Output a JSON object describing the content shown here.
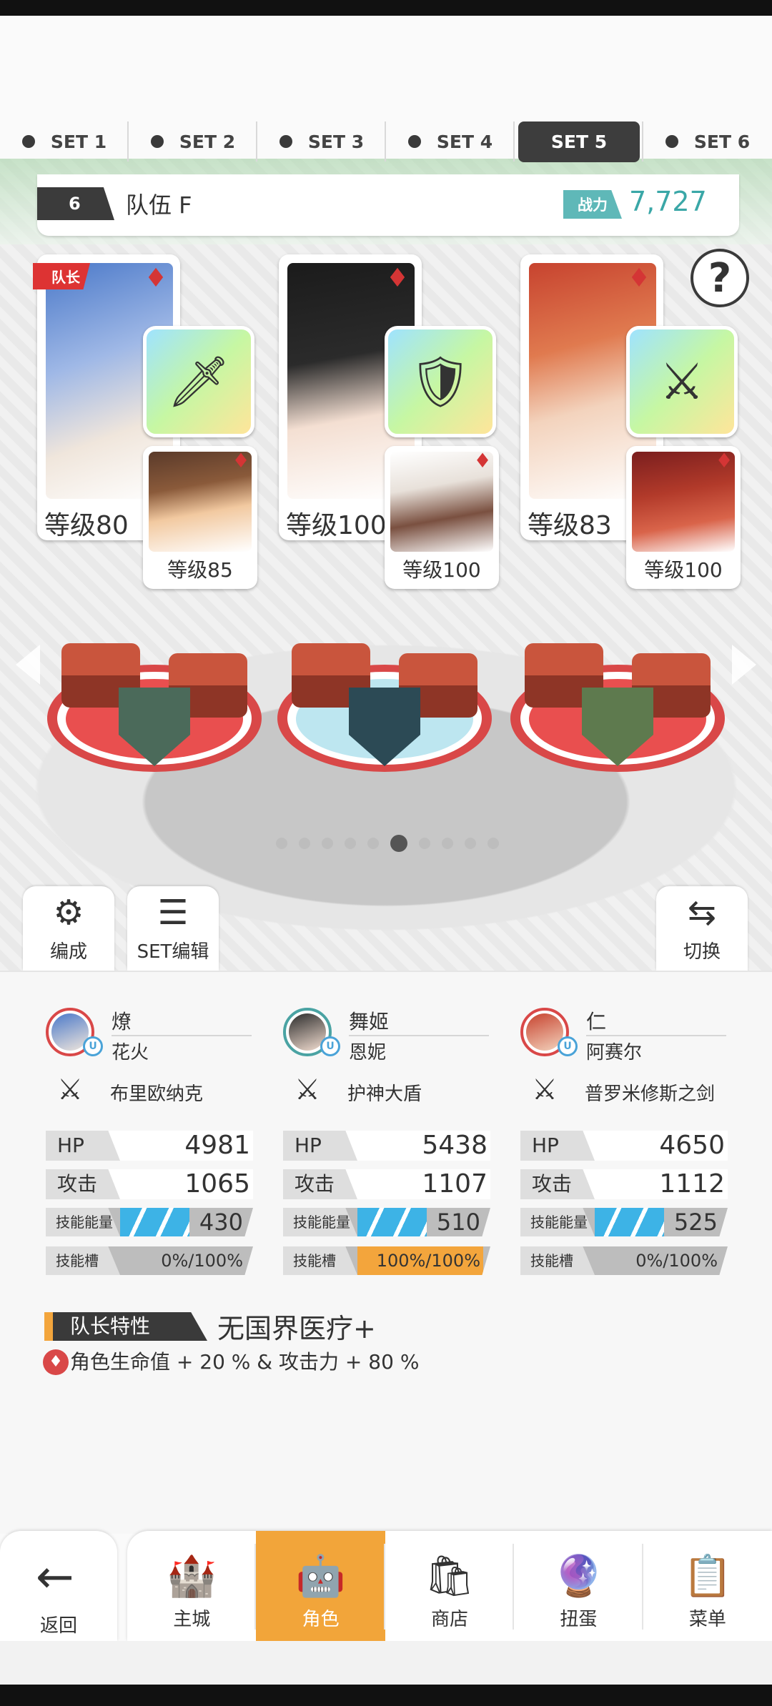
{
  "sets": [
    {
      "label": "SET 1",
      "active": false
    },
    {
      "label": "SET 2",
      "active": false
    },
    {
      "label": "SET 3",
      "active": false
    },
    {
      "label": "SET 4",
      "active": false
    },
    {
      "label": "SET 5",
      "active": true
    },
    {
      "label": "SET 6",
      "active": false
    }
  ],
  "team": {
    "number": "6",
    "name": "队伍 F",
    "power_label": "战力",
    "power_value": "7,727"
  },
  "help_symbol": "?",
  "leader_tag": "队长",
  "heroes": [
    {
      "level": "等级80",
      "sub_level": "等级85",
      "equip_icon": "staff-icon",
      "colors": {
        "main": "#4b79c9",
        "sub": "#8a5a3a"
      }
    },
    {
      "level": "等级100",
      "sub_level": "等级100",
      "equip_icon": "shield-emblem-icon",
      "colors": {
        "main": "#2b2b2b",
        "sub": "#e8e1da"
      }
    },
    {
      "level": "等级83",
      "sub_level": "等级100",
      "equip_icon": "sword-icon",
      "colors": {
        "main": "#c7432f",
        "sub": "#b23a2a"
      }
    }
  ],
  "pager": {
    "count": 10,
    "active_index": 5
  },
  "actions": {
    "formation": "编成",
    "set_edit": "SET编辑",
    "switch": "切换"
  },
  "members": [
    {
      "name": "燎",
      "sub_name": "花火",
      "weapon": "布里欧纳克",
      "hp_label": "HP",
      "hp": "4981",
      "atk_label": "攻击",
      "atk": "1065",
      "energy_label": "技能能量",
      "energy": "430",
      "energy_fraction": 0.55,
      "slot_label": "技能槽",
      "slot": "0%/100%",
      "slot_fraction": 0.0
    },
    {
      "name": "舞姬",
      "sub_name": "恩妮",
      "weapon": "护神大盾",
      "hp_label": "HP",
      "hp": "5438",
      "atk_label": "攻击",
      "atk": "1107",
      "energy_label": "技能能量",
      "energy": "510",
      "energy_fraction": 0.55,
      "slot_label": "技能槽",
      "slot": "100%/100%",
      "slot_fraction": 1.0
    },
    {
      "name": "仁",
      "sub_name": "阿赛尔",
      "weapon": "普罗米修斯之剑",
      "hp_label": "HP",
      "hp": "4650",
      "atk_label": "攻击",
      "atk": "1112",
      "energy_label": "技能能量",
      "energy": "525",
      "energy_fraction": 0.55,
      "slot_label": "技能槽",
      "slot": "0%/100%",
      "slot_fraction": 0.0
    }
  ],
  "leader_trait": {
    "label": "队长特性",
    "name": "无国界医疗+",
    "description": "角色生命值 + 20 % & 攻击力 + 80 %"
  },
  "nav": {
    "back": "返回",
    "items": [
      {
        "label": "主城",
        "icon": "castle-icon",
        "active": false
      },
      {
        "label": "角色",
        "icon": "character-icon",
        "active": true
      },
      {
        "label": "商店",
        "icon": "shop-icon",
        "active": false
      },
      {
        "label": "扭蛋",
        "icon": "gacha-icon",
        "active": false
      },
      {
        "label": "菜单",
        "icon": "menu-icon",
        "active": false
      }
    ]
  },
  "colors": {
    "accent": "#f2a53a",
    "power": "#3aa7a7",
    "suit": "#d43535",
    "energy": "#3db3e6"
  }
}
